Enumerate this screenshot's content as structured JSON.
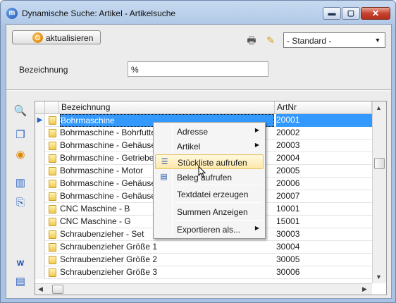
{
  "window": {
    "title": "Dynamische Suche: Artikel - Artikelsuche",
    "app_icon": "m",
    "controls": {
      "minimize": "▬",
      "maximize": "▢",
      "close": "✕"
    }
  },
  "toolbar": {
    "refresh_label": "aktualisieren",
    "preset_value": "- Standard -",
    "preset_arrow": "▼",
    "printer_icon": "🖶",
    "wand_icon": "✎"
  },
  "filter": {
    "label": "Bezeichnung",
    "value": "%"
  },
  "side_icons": [
    "search-icon",
    "copy-icon",
    "refresh-icon",
    "chart-icon",
    "link-icon",
    "word-icon",
    "export-icon"
  ],
  "side_glyphs": [
    "🔍",
    "❐",
    "◉",
    "▥",
    "⎘",
    "W",
    "▤"
  ],
  "grid": {
    "columns": [
      "Bezeichnung",
      "ArtNr"
    ],
    "row_indicator": "▶",
    "rows": [
      {
        "name": "Bohrmaschine",
        "nr": "20001",
        "selected": true
      },
      {
        "name": "Bohrmaschine - Bohrfutter",
        "nr": "20002"
      },
      {
        "name": "Bohrmaschine - Gehäuse",
        "nr": "20003"
      },
      {
        "name": "Bohrmaschine - Getriebe",
        "nr": "20004"
      },
      {
        "name": "Bohrmaschine - Motor",
        "nr": "20005"
      },
      {
        "name": "Bohrmaschine - Gehäuseteil",
        "nr": "20006"
      },
      {
        "name": "Bohrmaschine - Gehäuseteil",
        "nr": "20007"
      },
      {
        "name": "CNC Maschine - B",
        "nr": "10001"
      },
      {
        "name": "CNC Maschine - G",
        "nr": "15001"
      },
      {
        "name": "Schraubenzieher - Set",
        "nr": "30003"
      },
      {
        "name": "Schraubenzieher Größe 1",
        "nr": "30004"
      },
      {
        "name": "Schraubenzieher Größe 2",
        "nr": "30005"
      },
      {
        "name": "Schraubenzieher Größe 3",
        "nr": "30006"
      }
    ],
    "scroll": {
      "up": "▲",
      "down": "▼",
      "left": "◀",
      "right": "▶"
    }
  },
  "context_menu": {
    "items": [
      {
        "label": "Adresse",
        "submenu": true
      },
      {
        "label": "Artikel",
        "submenu": true
      },
      {
        "label": "Stückliste aufrufen",
        "icon": "tree-icon",
        "glyph": "☰",
        "highlighted": true
      },
      {
        "label": "Beleg aufrufen",
        "icon": "document-icon",
        "glyph": "▤"
      },
      {
        "label": "Textdatei erzeugen"
      },
      {
        "label": "Summen Anzeigen"
      },
      {
        "label": "Exportieren als...",
        "submenu": true
      }
    ],
    "submenu_glyph": "▶"
  },
  "colors": {
    "selection": "#3399ff",
    "menu_highlight": "#fde8a9",
    "title_gradient": "#b3cbe8"
  }
}
